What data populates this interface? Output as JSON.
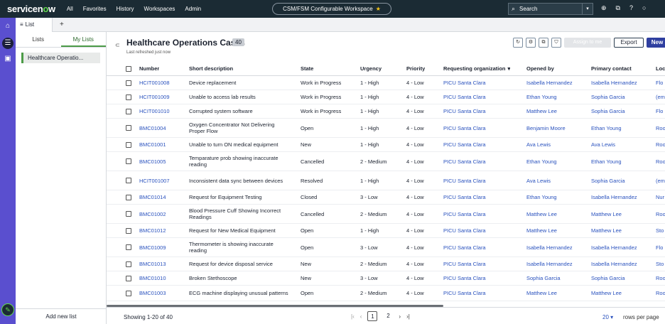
{
  "topbar": {
    "logo": "servicenow",
    "nav": [
      "All",
      "Favorites",
      "History",
      "Workspaces",
      "Admin"
    ],
    "workspace": "CSM/FSM Configurable Workspace",
    "search_placeholder": "Search"
  },
  "tabbar": {
    "tab_label": "List"
  },
  "left_panel": {
    "tabs": [
      "Lists",
      "My Lists"
    ],
    "selected_item": "Healthcare Operatio...",
    "add_label": "Add new list"
  },
  "list": {
    "title": "Healthcare Operations Cases",
    "count": "40",
    "refreshed": "Last refreshed just now",
    "assign_label": "Assign to me",
    "export_label": "Export",
    "new_label": "New",
    "columns": [
      "Number",
      "Short description",
      "State",
      "Urgency",
      "Priority",
      "Requesting organization",
      "Opened by",
      "Primary contact",
      "Loc"
    ],
    "rows": [
      [
        "HCIT001008",
        "Device replacement",
        "Work in Progress",
        "1 - High",
        "4 - Low",
        "PICU Santa Clara",
        "Isabella Hernandez",
        "Isabella Hernandez",
        "Flo"
      ],
      [
        "HCIT001009",
        "Unable to access lab results",
        "Work in Progress",
        "1 - High",
        "4 - Low",
        "PICU Santa Clara",
        "Ethan Young",
        "Sophia Garcia",
        "(em"
      ],
      [
        "HCIT001010",
        "Corrupted system software",
        "Work in Progress",
        "1 - High",
        "4 - Low",
        "PICU Santa Clara",
        "Matthew Lee",
        "Sophia Garcia",
        "Flo"
      ],
      [
        "BMC01004",
        "Oxygen Concentrator Not Delivering Proper Flow",
        "Open",
        "1 - High",
        "4 - Low",
        "PICU Santa Clara",
        "Benjamin Moore",
        "Ethan Young",
        "Roo"
      ],
      [
        "BMC01001",
        "Unable to turn ON medical equipment",
        "New",
        "1 - High",
        "4 - Low",
        "PICU Santa Clara",
        "Ava Lewis",
        "Ava Lewis",
        "Roo"
      ],
      [
        "BMC01005",
        "Temparature prob showing inaccurate reading",
        "Cancelled",
        "2 - Medium",
        "4 - Low",
        "PICU Santa Clara",
        "Ethan Young",
        "Ethan Young",
        "Roo"
      ],
      [
        "HCIT001007",
        "Inconsistent data sync between devices",
        "Resolved",
        "1 - High",
        "4 - Low",
        "PICU Santa Clara",
        "Ava Lewis",
        "Sophia Garcia",
        "(em"
      ],
      [
        "BMC01014",
        "Request for Equipment Testing",
        "Closed",
        "3 - Low",
        "4 - Low",
        "PICU Santa Clara",
        "Ethan Young",
        "Isabella Hernandez",
        "Nur"
      ],
      [
        "BMC01002",
        "Blood Pressure Cuff Showing Incorrect Readings",
        "Cancelled",
        "2 - Medium",
        "4 - Low",
        "PICU Santa Clara",
        "Matthew Lee",
        "Matthew Lee",
        "Roo"
      ],
      [
        "BMC01012",
        "Request for New Medical Equipment",
        "Open",
        "1 - High",
        "4 - Low",
        "PICU Santa Clara",
        "Matthew Lee",
        "Matthew Lee",
        "Sto"
      ],
      [
        "BMC01009",
        "Thermometer is showing inaccurate reading",
        "Open",
        "3 - Low",
        "4 - Low",
        "PICU Santa Clara",
        "Isabella Hernandez",
        "Isabella Hernandez",
        "Flo"
      ],
      [
        "BMC01013",
        "Request for device disposal service",
        "New",
        "2 - Medium",
        "4 - Low",
        "PICU Santa Clara",
        "Isabella Hernandez",
        "Isabella Hernandez",
        "Sto"
      ],
      [
        "BMC01010",
        "Broken Stethoscope",
        "New",
        "3 - Low",
        "4 - Low",
        "PICU Santa Clara",
        "Sophia Garcia",
        "Sophia Garcia",
        "Roo"
      ],
      [
        "BMC01003",
        "ECG machine displaying unusual patterns",
        "Open",
        "2 - Medium",
        "4 - Low",
        "PICU Santa Clara",
        "Matthew Lee",
        "Matthew Lee",
        "Roo"
      ]
    ]
  },
  "footer": {
    "showing": "Showing 1-20 of 40",
    "pages": [
      "1",
      "2"
    ],
    "rows_per_page_value": "20",
    "rows_per_page_label": "rows per page"
  },
  "colors": {
    "accent": "#2a52be",
    "rail": "#5a4fcf",
    "topbar": "#1b2b34",
    "new_button": "#2f3fa0",
    "selected_green": "#4c9b47"
  }
}
